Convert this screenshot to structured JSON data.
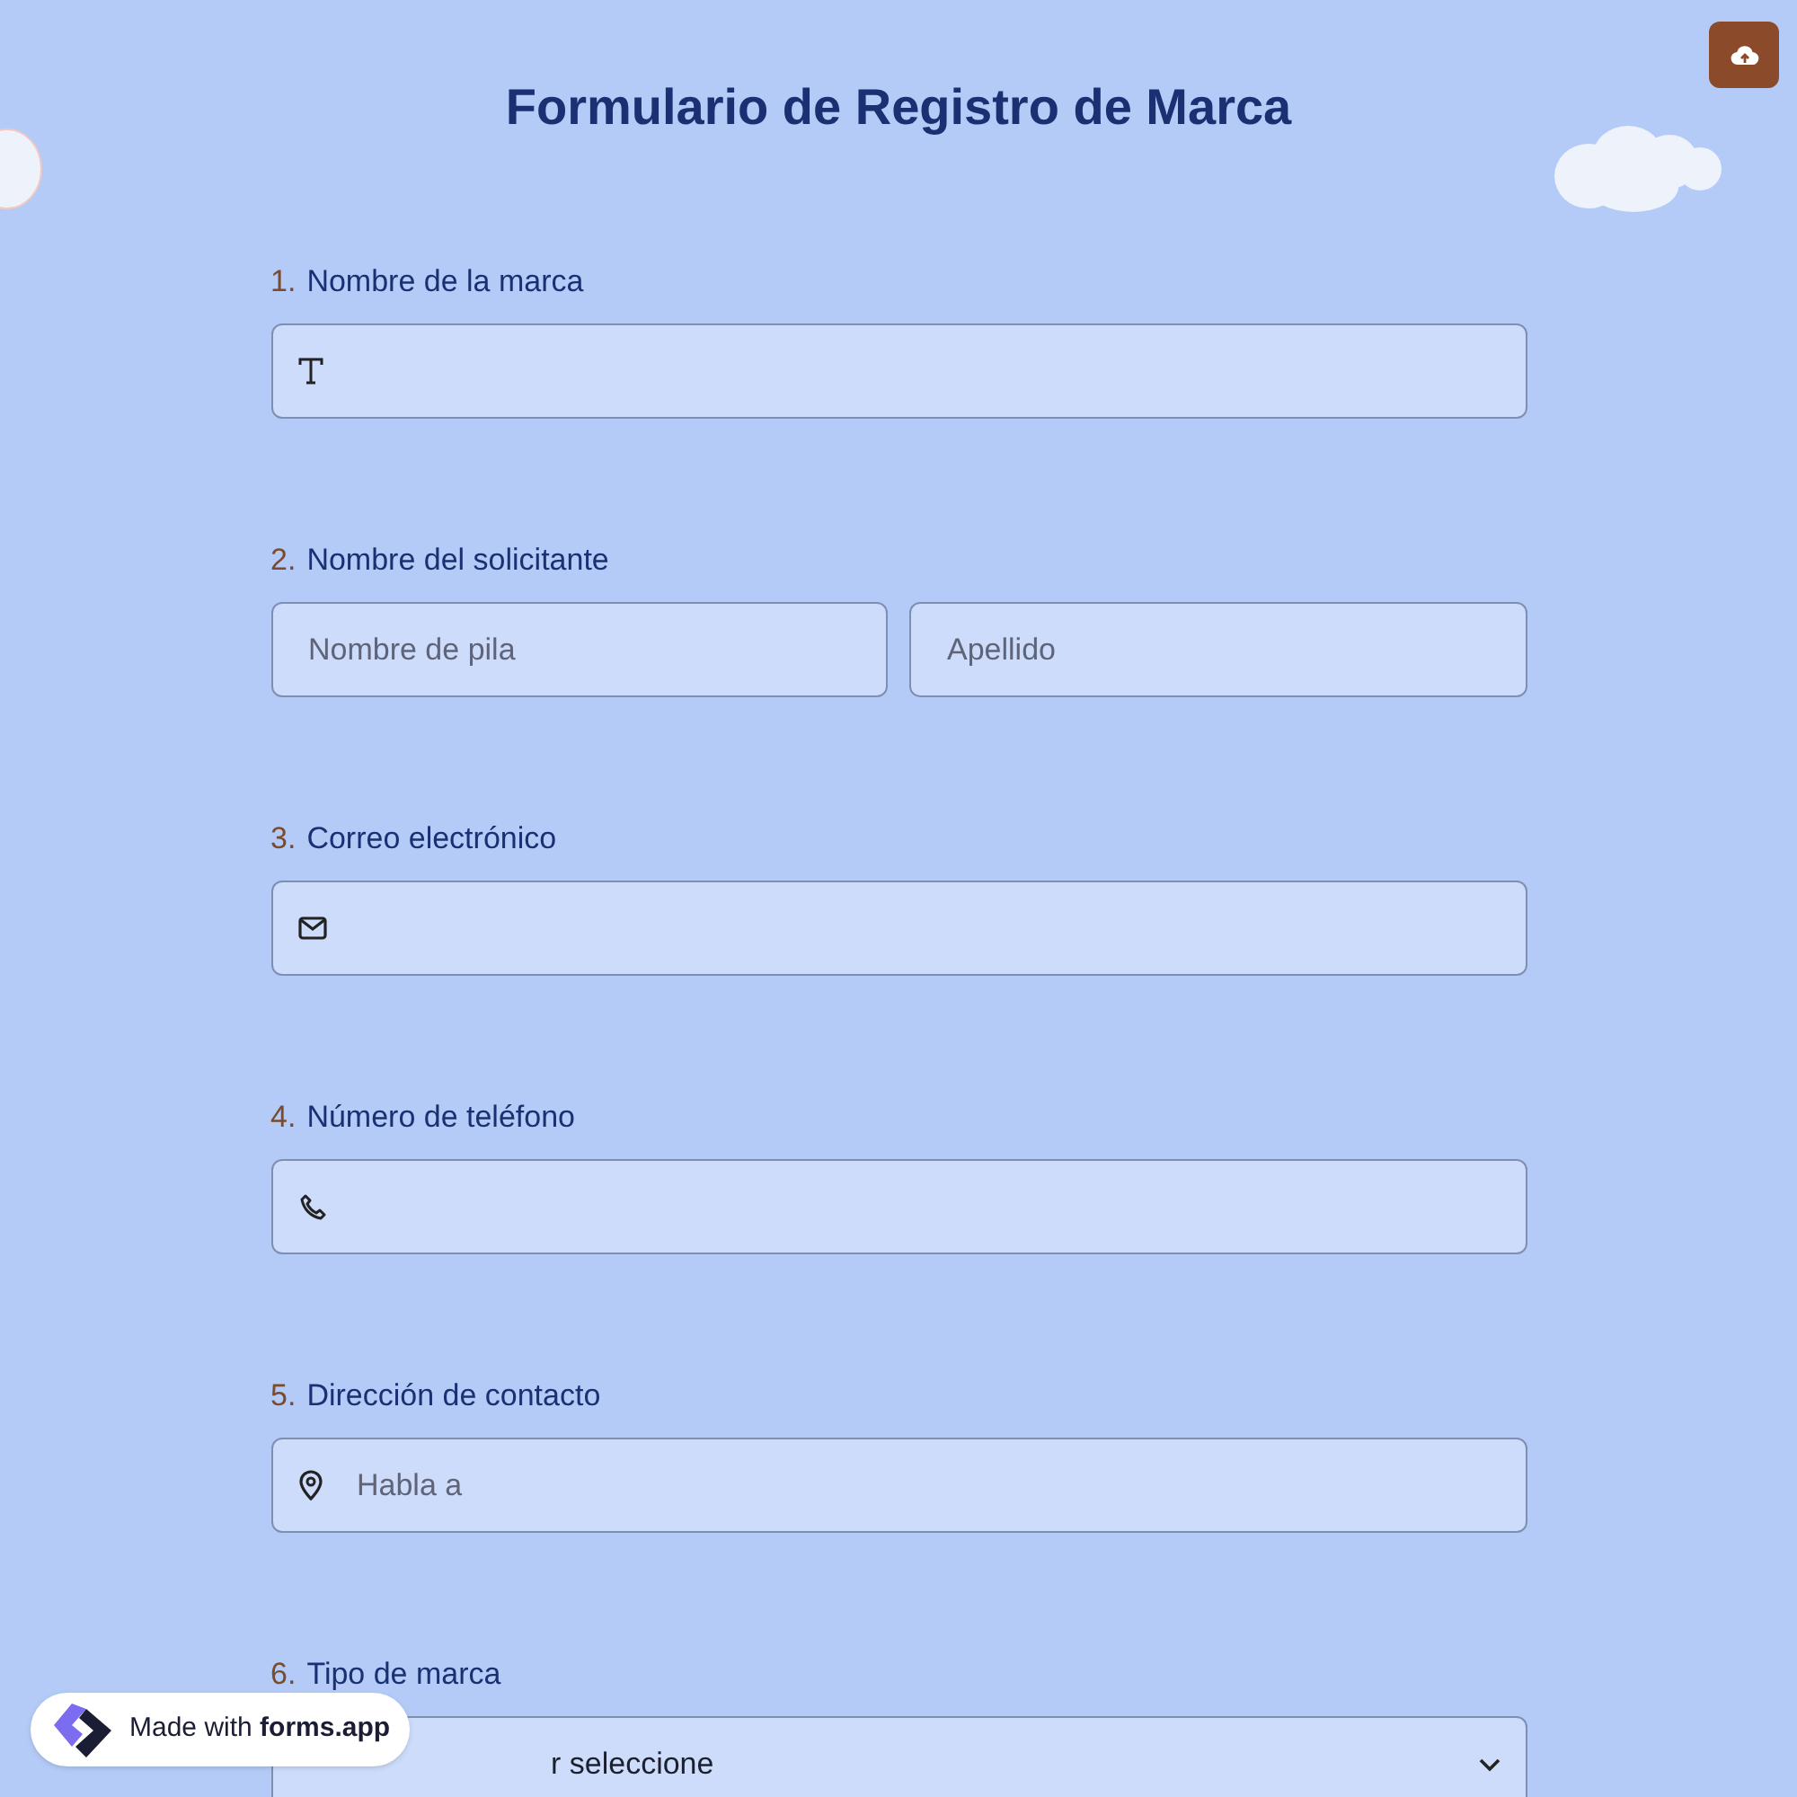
{
  "title": "Formulario de Registro de Marca",
  "questions": [
    {
      "number": "1.",
      "label": "Nombre de la marca",
      "kind": "text"
    },
    {
      "number": "2.",
      "label": "Nombre del solicitante",
      "kind": "name",
      "fields": [
        {
          "placeholder": "Nombre de pila"
        },
        {
          "placeholder": "Apellido"
        }
      ]
    },
    {
      "number": "3.",
      "label": "Correo electrónico",
      "kind": "email"
    },
    {
      "number": "4.",
      "label": "Número de teléfono",
      "kind": "phone"
    },
    {
      "number": "5.",
      "label": "Dirección de contacto",
      "kind": "address",
      "placeholder": "Habla a"
    },
    {
      "number": "6.",
      "label": "Tipo de marca",
      "kind": "select",
      "placeholder": "r seleccione"
    }
  ],
  "badge": "Made with **forms.app**"
}
